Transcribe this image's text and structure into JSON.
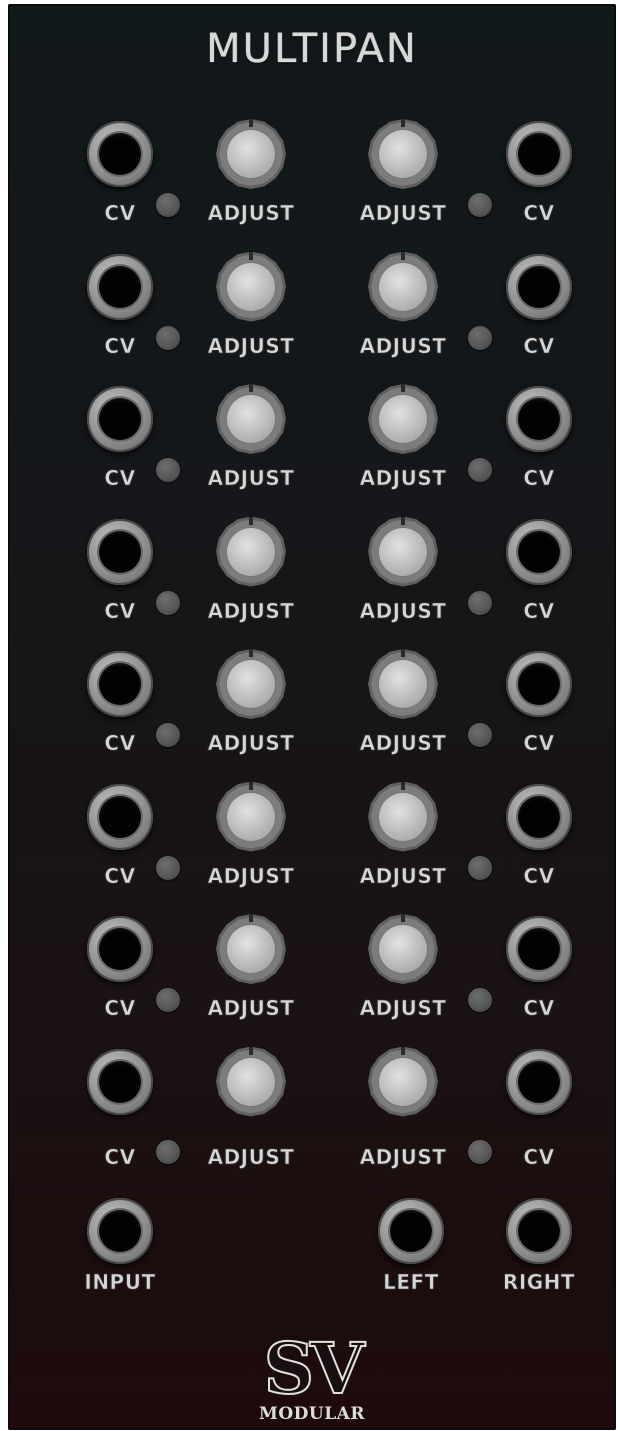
{
  "module": {
    "title": "MULTIPAN",
    "panel_color_top": "#11181a",
    "panel_color_bottom": "#1e0a0b"
  },
  "channels": [
    {
      "left_cv_label": "CV",
      "left_knob_label": "ADJUST",
      "right_knob_label": "ADJUST",
      "right_cv_label": "CV"
    },
    {
      "left_cv_label": "CV",
      "left_knob_label": "ADJUST",
      "right_knob_label": "ADJUST",
      "right_cv_label": "CV"
    },
    {
      "left_cv_label": "CV",
      "left_knob_label": "ADJUST",
      "right_knob_label": "ADJUST",
      "right_cv_label": "CV"
    },
    {
      "left_cv_label": "CV",
      "left_knob_label": "ADJUST",
      "right_knob_label": "ADJUST",
      "right_cv_label": "CV"
    },
    {
      "left_cv_label": "CV",
      "left_knob_label": "ADJUST",
      "right_knob_label": "ADJUST",
      "right_cv_label": "CV"
    },
    {
      "left_cv_label": "CV",
      "left_knob_label": "ADJUST",
      "right_knob_label": "ADJUST",
      "right_cv_label": "CV"
    },
    {
      "left_cv_label": "CV",
      "left_knob_label": "ADJUST",
      "right_knob_label": "ADJUST",
      "right_cv_label": "CV"
    },
    {
      "left_cv_label": "CV",
      "left_knob_label": "ADJUST",
      "right_knob_label": "ADJUST",
      "right_cv_label": "CV"
    }
  ],
  "outputs": {
    "input_label": "INPUT",
    "left_label": "LEFT",
    "right_label": "RIGHT"
  },
  "logo": {
    "brand": "SV",
    "subtitle": "MODULAR"
  }
}
